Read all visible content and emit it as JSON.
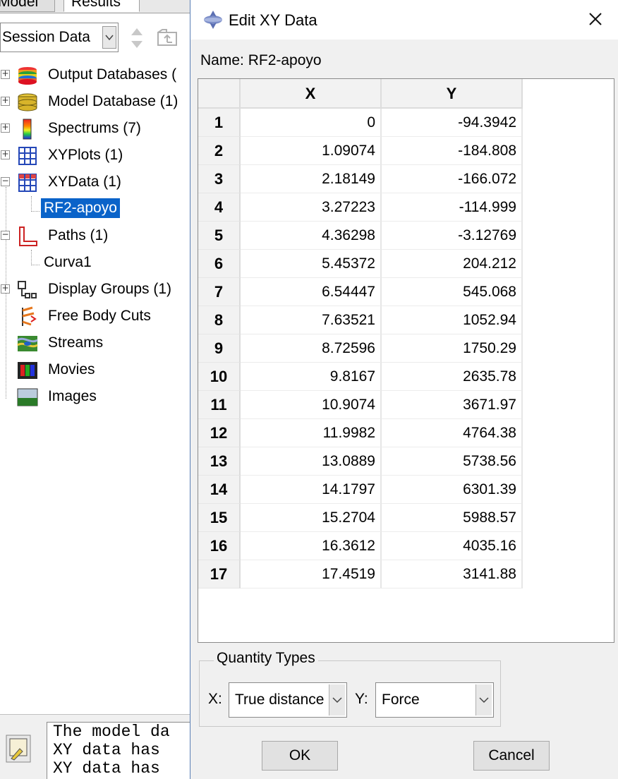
{
  "left": {
    "tabs": [
      "Model",
      "Results"
    ],
    "session_select": "Session Data",
    "tree": [
      {
        "label": "Output Databases (",
        "expander": "+"
      },
      {
        "label": "Model Database (1)",
        "expander": "+"
      },
      {
        "label": "Spectrums (7)",
        "expander": "+"
      },
      {
        "label": "XYPlots (1)",
        "expander": "+"
      },
      {
        "label": "XYData (1)",
        "expander": "−"
      },
      {
        "label": "Paths (1)",
        "expander": "−"
      },
      {
        "label": "Display Groups (1)",
        "expander": "+"
      },
      {
        "label": "Free Body Cuts",
        "expander": ""
      },
      {
        "label": "Streams",
        "expander": ""
      },
      {
        "label": "Movies",
        "expander": ""
      },
      {
        "label": "Images",
        "expander": ""
      }
    ],
    "xydata_child": "RF2-apoyo",
    "paths_child": "Curva1",
    "messages": [
      "The model da",
      "XY data has",
      "XY data has"
    ]
  },
  "dialog": {
    "title": "Edit XY Data",
    "name_label": "Name:",
    "name_value": "RF2-apoyo",
    "columns": [
      "X",
      "Y"
    ],
    "rows": [
      {
        "n": "1",
        "x": "0",
        "y": "-94.3942"
      },
      {
        "n": "2",
        "x": "1.09074",
        "y": "-184.808"
      },
      {
        "n": "3",
        "x": "2.18149",
        "y": "-166.072"
      },
      {
        "n": "4",
        "x": "3.27223",
        "y": "-114.999"
      },
      {
        "n": "5",
        "x": "4.36298",
        "y": "-3.12769"
      },
      {
        "n": "6",
        "x": "5.45372",
        "y": "204.212"
      },
      {
        "n": "7",
        "x": "6.54447",
        "y": "545.068"
      },
      {
        "n": "8",
        "x": "7.63521",
        "y": "1052.94"
      },
      {
        "n": "9",
        "x": "8.72596",
        "y": "1750.29"
      },
      {
        "n": "10",
        "x": "9.8167",
        "y": "2635.78"
      },
      {
        "n": "11",
        "x": "10.9074",
        "y": "3671.97"
      },
      {
        "n": "12",
        "x": "11.9982",
        "y": "4764.38"
      },
      {
        "n": "13",
        "x": "13.0889",
        "y": "5738.56"
      },
      {
        "n": "14",
        "x": "14.1797",
        "y": "6301.39"
      },
      {
        "n": "15",
        "x": "15.2704",
        "y": "5988.57"
      },
      {
        "n": "16",
        "x": "16.3612",
        "y": "4035.16"
      },
      {
        "n": "17",
        "x": "17.4519",
        "y": "3141.88"
      }
    ],
    "quantity_types": {
      "legend": "Quantity Types",
      "x_label": "X:",
      "x_value": "True distance",
      "y_label": "Y:",
      "y_value": "Force"
    },
    "ok_label": "OK",
    "cancel_label": "Cancel"
  }
}
